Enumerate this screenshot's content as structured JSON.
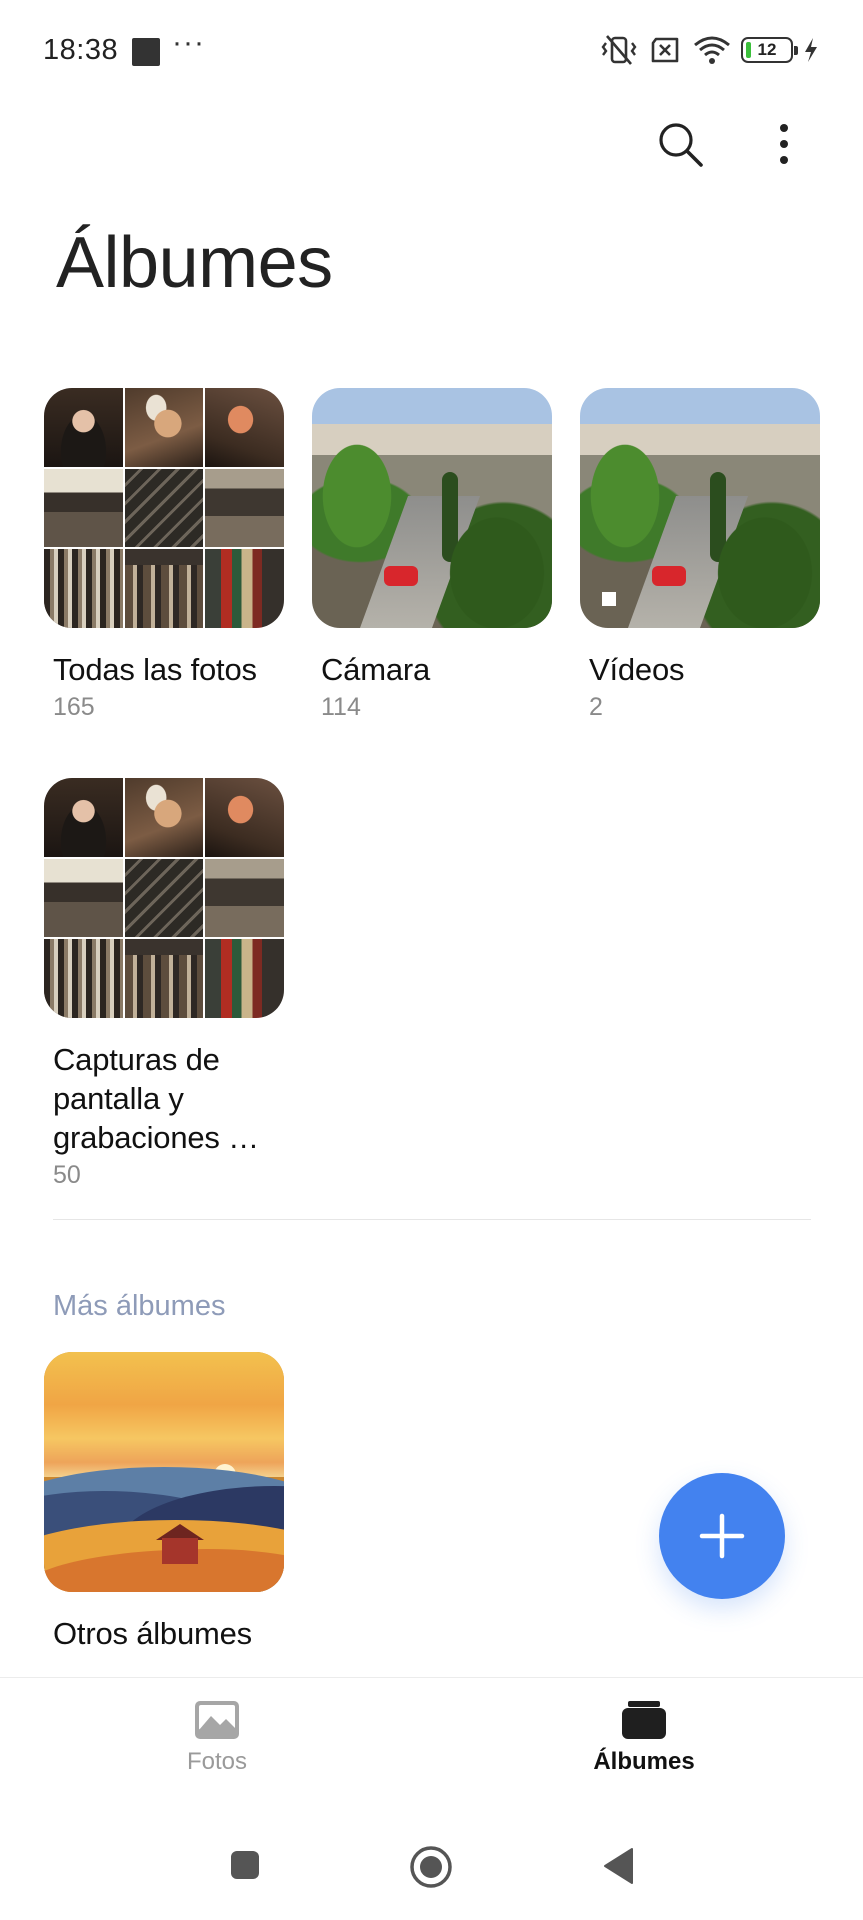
{
  "status_bar": {
    "time": "18:38",
    "dots": "···",
    "battery_level": "12"
  },
  "toolbar": {
    "search_icon": "search-icon",
    "more_icon": "more-vert-icon"
  },
  "page": {
    "title": "Álbumes"
  },
  "albums": [
    {
      "name": "Todas las fotos",
      "count": "165"
    },
    {
      "name": "Cámara",
      "count": "114"
    },
    {
      "name": "Vídeos",
      "count": "2"
    },
    {
      "name": "Capturas de pantalla y grabaciones …",
      "count": "50"
    }
  ],
  "more_section": {
    "title": "Más álbumes",
    "albums": [
      {
        "name": "Otros álbumes"
      }
    ]
  },
  "fab": {
    "icon": "plus-icon"
  },
  "bottom_nav": {
    "items": [
      {
        "label": "Fotos",
        "icon": "image-icon",
        "active": false
      },
      {
        "label": "Álbumes",
        "icon": "album-icon",
        "active": true
      }
    ]
  },
  "system_nav": {
    "recents_icon": "square-icon",
    "home_icon": "circle-icon",
    "back_icon": "triangle-back-icon"
  },
  "colors": {
    "accent": "#4382ef",
    "section_title": "#8e9bb8",
    "battery_fill": "#3bbf3b"
  }
}
